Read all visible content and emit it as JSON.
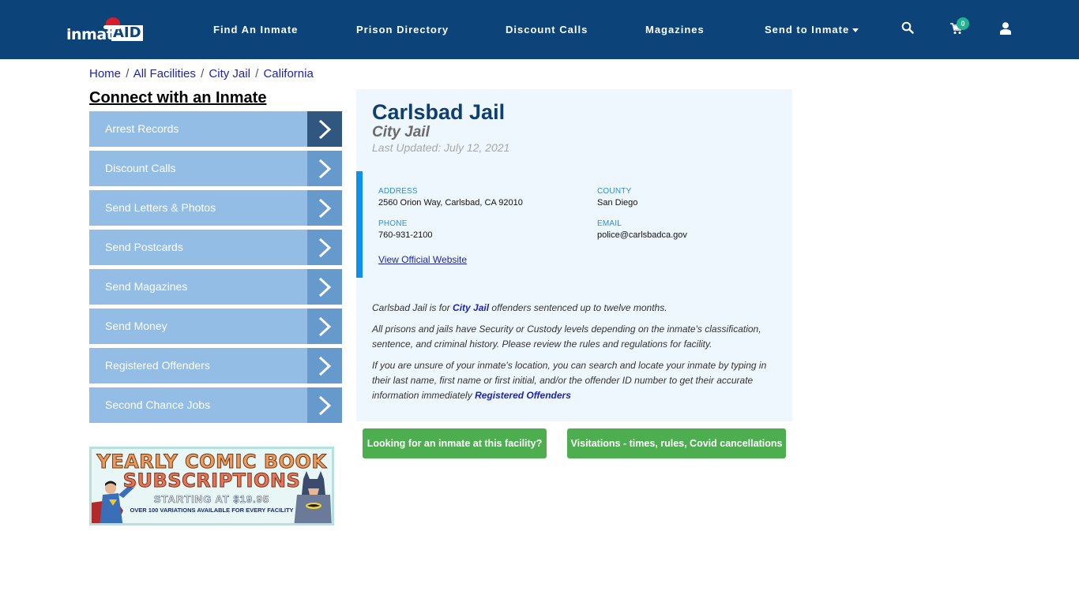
{
  "header": {
    "logo": {
      "text": "inmate",
      "accent": "AID"
    },
    "nav": [
      {
        "label": "Find An Inmate"
      },
      {
        "label": "Prison Directory"
      },
      {
        "label": "Discount Calls"
      },
      {
        "label": "Magazines"
      },
      {
        "label": "Send to Inmate",
        "has_dropdown": true
      }
    ],
    "icons": {
      "search": "search-icon",
      "cart": "cart-icon",
      "user": "user-icon"
    },
    "cart_count": "0",
    "colors": {
      "bar": "#0c4479",
      "badge": "#1fb38f"
    }
  },
  "breadcrumb": [
    {
      "label": "Home"
    },
    {
      "label": "All Facilities"
    },
    {
      "label": "City Jail"
    },
    {
      "label": "California"
    }
  ],
  "breadcrumb_separator": "/",
  "sidebar": {
    "title": "Connect with an Inmate",
    "items": [
      {
        "label": "Arrest Records"
      },
      {
        "label": "Discount Calls"
      },
      {
        "label": "Send Letters & Photos"
      },
      {
        "label": "Send Postcards"
      },
      {
        "label": "Send Magazines"
      },
      {
        "label": "Send Money"
      },
      {
        "label": "Registered Offenders"
      },
      {
        "label": "Second Chance Jobs"
      }
    ],
    "promo": {
      "line1": "YEARLY COMIC BOOK",
      "line2": "SUBSCRIPTIONS",
      "line3": "STARTING AT $19.95",
      "line4": "OVER 100 VARIATIONS AVAILABLE FOR EVERY FACILITY"
    }
  },
  "facility": {
    "name": "Carlsbad Jail",
    "type": "City Jail",
    "last_updated": "Last Updated: July 12, 2021",
    "address_label": "ADDRESS",
    "address": "2560 Orion Way, Carlsbad, CA 92010",
    "county_label": "COUNTY",
    "county": "San Diego",
    "phone_label": "PHONE",
    "phone": "760-931-2100",
    "email_label": "EMAIL",
    "email": "police@carlsbadca.gov",
    "website_link": "View Official Website",
    "desc1_pre": "Carlsbad Jail is for ",
    "desc1_link": "City Jail",
    "desc1_post": " offenders sentenced up to twelve months.",
    "desc2": "All prisons and jails have Security or Custody levels depending on the inmate's classification, sentence, and criminal history. Please review the rules and regulations for facility.",
    "desc3_pre": "If you are unsure of your inmate's location, you can search and locate your inmate by typing in their last name, first name or first initial, and/or the offender ID number to get their accurate information immediately ",
    "desc3_link": "Registered Offenders"
  },
  "actions": {
    "find_inmate": "Looking for an inmate at this facility?",
    "visitations": "Visitations - times, rules, Covid cancellations"
  }
}
